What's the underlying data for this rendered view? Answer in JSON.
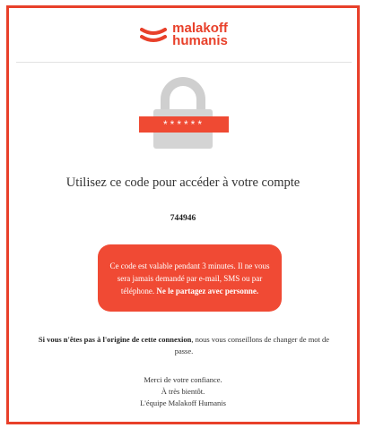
{
  "brand": {
    "line1": "malakoff",
    "line2": "humanis",
    "accent_color": "#e8402a"
  },
  "lock": {
    "icon": "padlock-icon",
    "mask_text": "******"
  },
  "message": {
    "heading": "Utilisez ce code pour accéder à votre compte",
    "code": "744946"
  },
  "notice": {
    "text": "Ce code est valable pendant 3 minutes. Il ne vous sera jamais demandé par e-mail, SMS ou par téléphone.",
    "bold_text": "Ne le partagez avec personne."
  },
  "advice": {
    "bold_text": "Si vous n'êtes pas à l'origine de cette connexion",
    "text": ", nous vous conseillons de changer de mot de passe."
  },
  "signoff": {
    "line1": "Merci de votre confiance.",
    "line2": "À très bientôt.",
    "line3": "L'équipe Malakoff Humanis"
  }
}
